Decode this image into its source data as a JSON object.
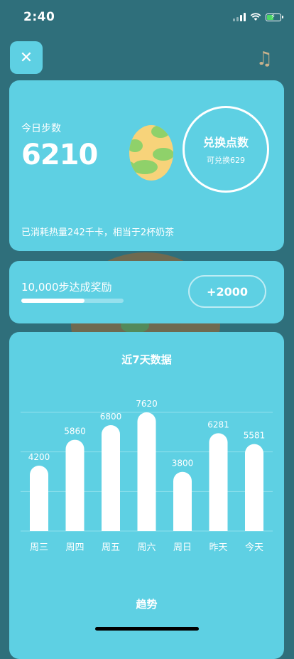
{
  "status_bar": {
    "time": "2:40"
  },
  "header": {
    "close_icon": "✕",
    "music_icon": "♫"
  },
  "steps_card": {
    "label": "今日步数",
    "value": "6210",
    "exchange_title": "兑换点数",
    "exchange_sub": "可兑换629",
    "calories_text": "已消耗热量242千卡，相当于2杯奶茶"
  },
  "goal_card": {
    "label": "10,000步达成奖励",
    "progress": 0.621,
    "button_label": "+2000"
  },
  "chart_card": {
    "title": "近7天数据",
    "trend_label": "趋势"
  },
  "chart_data": {
    "type": "bar",
    "title": "近7天数据",
    "categories": [
      "周三",
      "周四",
      "周五",
      "周六",
      "周日",
      "昨天",
      "今天"
    ],
    "values": [
      4200,
      5860,
      6800,
      7620,
      3800,
      6281,
      5581
    ],
    "ylim": [
      0,
      7620
    ],
    "grid": true,
    "colors": {
      "bar": "#ffffff",
      "grid": "#8fe0ec",
      "label": "#ffffff"
    }
  }
}
